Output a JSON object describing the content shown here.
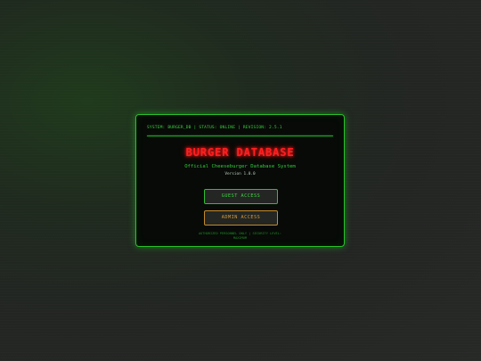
{
  "system_bar": {
    "text": "SYSTEM: BURGER_DB | STATUS: ONLINE | REVISION: 2.5.1"
  },
  "title": "BURGER DATABASE",
  "subtitle": "Official Cheeseburger Database System",
  "version": "Version 1.0.0",
  "buttons": {
    "guest": "GUEST ACCESS",
    "admin": "ADMIN ACCESS"
  },
  "footer": {
    "line1": "AUTHORIZED PERSONNEL ONLY | SECURITY LEVEL:",
    "line2": "MAXIMUM"
  },
  "colors": {
    "terminal_green": "#27c12a",
    "title_red": "#ff1f1f",
    "admin_orange": "#c38a2c",
    "panel_bg": "#070a07"
  }
}
